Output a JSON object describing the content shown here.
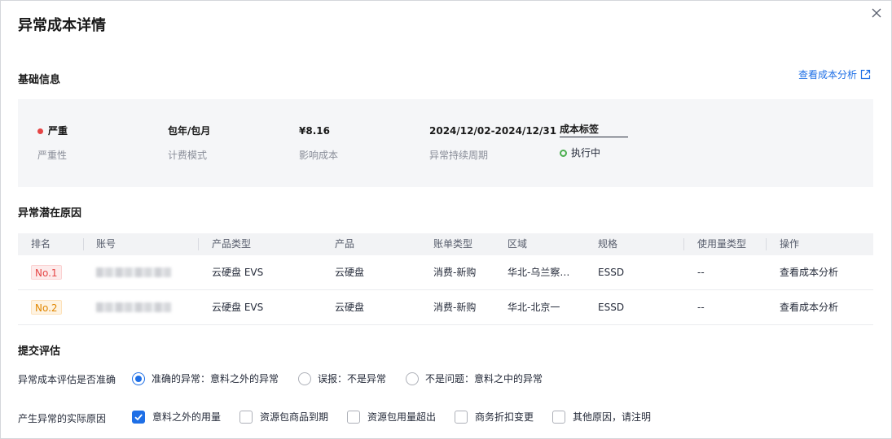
{
  "dialog": {
    "title": "异常成本详情"
  },
  "basic": {
    "section_title": "基础信息",
    "analysis_link": "查看成本分析",
    "severity": {
      "value": "严重",
      "label": "严重性"
    },
    "billing_mode": {
      "value": "包年/包月",
      "label": "计费模式"
    },
    "impact_cost": {
      "value": "¥8.16",
      "label": "影响成本"
    },
    "period": {
      "value": "2024/12/02-2024/12/31",
      "label": "异常持续周期"
    },
    "cost_tag": {
      "value": "成本标签",
      "status": "执行中"
    }
  },
  "causes": {
    "section_title": "异常潜在原因",
    "headers": [
      "排名",
      "账号",
      "产品类型",
      "产品",
      "账单类型",
      "区域",
      "规格",
      "使用量类型",
      "操作"
    ],
    "rows": [
      {
        "rank": "No.1",
        "product_type": "云硬盘 EVS",
        "product": "云硬盘",
        "bill_type": "消费-新购",
        "region": "华北-乌兰察…",
        "spec": "ESSD",
        "usage_type": "--",
        "action": "查看成本分析"
      },
      {
        "rank": "No.2",
        "product_type": "云硬盘 EVS",
        "product": "云硬盘",
        "bill_type": "消费-新购",
        "region": "华北-北京一",
        "spec": "ESSD",
        "usage_type": "--",
        "action": "查看成本分析"
      }
    ]
  },
  "evaluation": {
    "section_title": "提交评估",
    "accuracy_label": "异常成本评估是否准确",
    "accuracy_options": [
      "准确的异常：意料之外的异常",
      "误报：不是异常",
      "不是问题：意料之中的异常"
    ],
    "accuracy_selected": 0,
    "reason_label": "产生异常的实际原因",
    "reason_options": [
      "意料之外的用量",
      "资源包商品到期",
      "资源包用量超出",
      "商务折扣变更",
      "其他原因，请注明"
    ],
    "reason_checked": [
      true,
      false,
      false,
      false,
      false
    ]
  },
  "colors": {
    "accent": "#1e6fe6",
    "danger": "#e54545",
    "warning": "#e08600",
    "success": "#4caf50"
  },
  "icons": [
    "close-icon",
    "external-link-icon",
    "severity-dot-icon",
    "status-ring-icon",
    "radio-icon",
    "checkbox-icon",
    "checkmark-icon"
  ]
}
